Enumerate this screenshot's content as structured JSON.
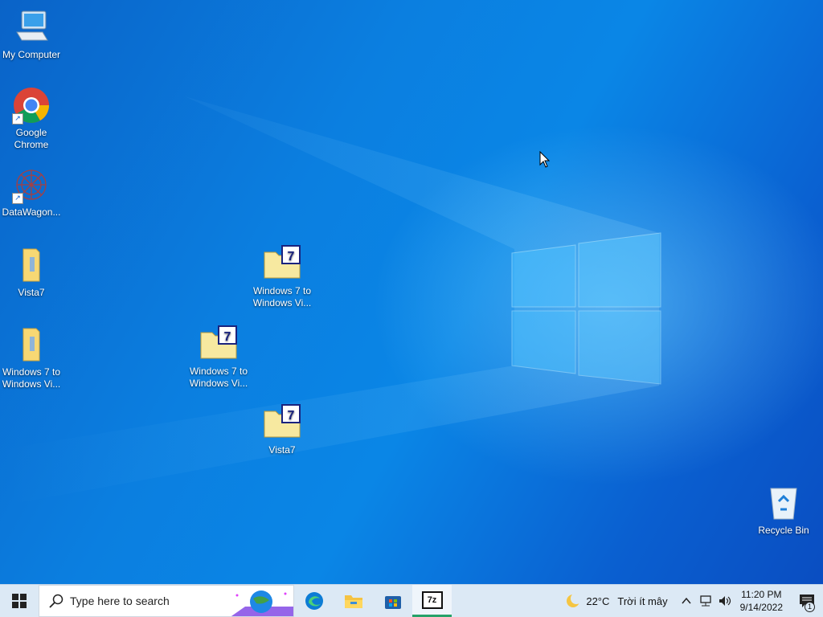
{
  "desktop": {
    "icons": [
      {
        "label": "My Computer",
        "icon": "computer-icon"
      },
      {
        "label": "Google Chrome",
        "icon": "chrome-icon"
      },
      {
        "label": "DataWagon...",
        "icon": "datawagon-icon"
      },
      {
        "label": "Vista7",
        "icon": "folder-icon"
      },
      {
        "label": "Windows 7 to Windows Vi...",
        "icon": "folder-icon"
      },
      {
        "label": "Windows 7 to Windows Vi...",
        "icon": "archive-folder-icon"
      },
      {
        "label": "Windows 7 to Windows Vi...",
        "icon": "archive-folder-icon"
      },
      {
        "label": "Vista7",
        "icon": "archive-folder-icon"
      },
      {
        "label": "Recycle Bin",
        "icon": "recycle-bin-icon"
      }
    ]
  },
  "taskbar": {
    "search_placeholder": "Type here to search",
    "apps": [
      "edge-icon",
      "file-explorer-icon",
      "store-icon",
      "7zip-icon"
    ],
    "weather": {
      "temp": "22°C",
      "condition": "Trời ít mây"
    },
    "clock": {
      "time": "11:20 PM",
      "date": "9/14/2022"
    },
    "notifications_count": "1",
    "sevenzip_label": "7z"
  },
  "colors": {
    "accent": "#0a78dc",
    "taskbar": "#dce9f5"
  }
}
